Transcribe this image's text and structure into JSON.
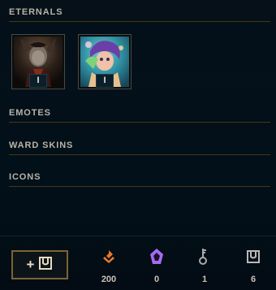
{
  "sections": {
    "eternals": "ETERNALS",
    "emotes": "EMOTES",
    "ward_skins": "WARD SKINS",
    "icons": "ICONS"
  },
  "eternals": [
    {
      "name": "eternal-dark-champion",
      "count": "I"
    },
    {
      "name": "eternal-neeko",
      "count": "I"
    }
  ],
  "footer": {
    "add_button_label": "+",
    "currencies": [
      {
        "icon": "orange-essence-icon",
        "value": "200",
        "color": "#e67b2c"
      },
      {
        "icon": "mythic-essence-icon",
        "value": "0",
        "color": "#a46bf0"
      },
      {
        "icon": "key-icon",
        "value": "1",
        "color": "#a9a9a9"
      },
      {
        "icon": "chest-icon",
        "value": "6",
        "color": "#b9b9b9"
      }
    ]
  },
  "colors": {
    "gold_border": "#7b6432",
    "divider": "#463714",
    "background": "#010a13"
  }
}
